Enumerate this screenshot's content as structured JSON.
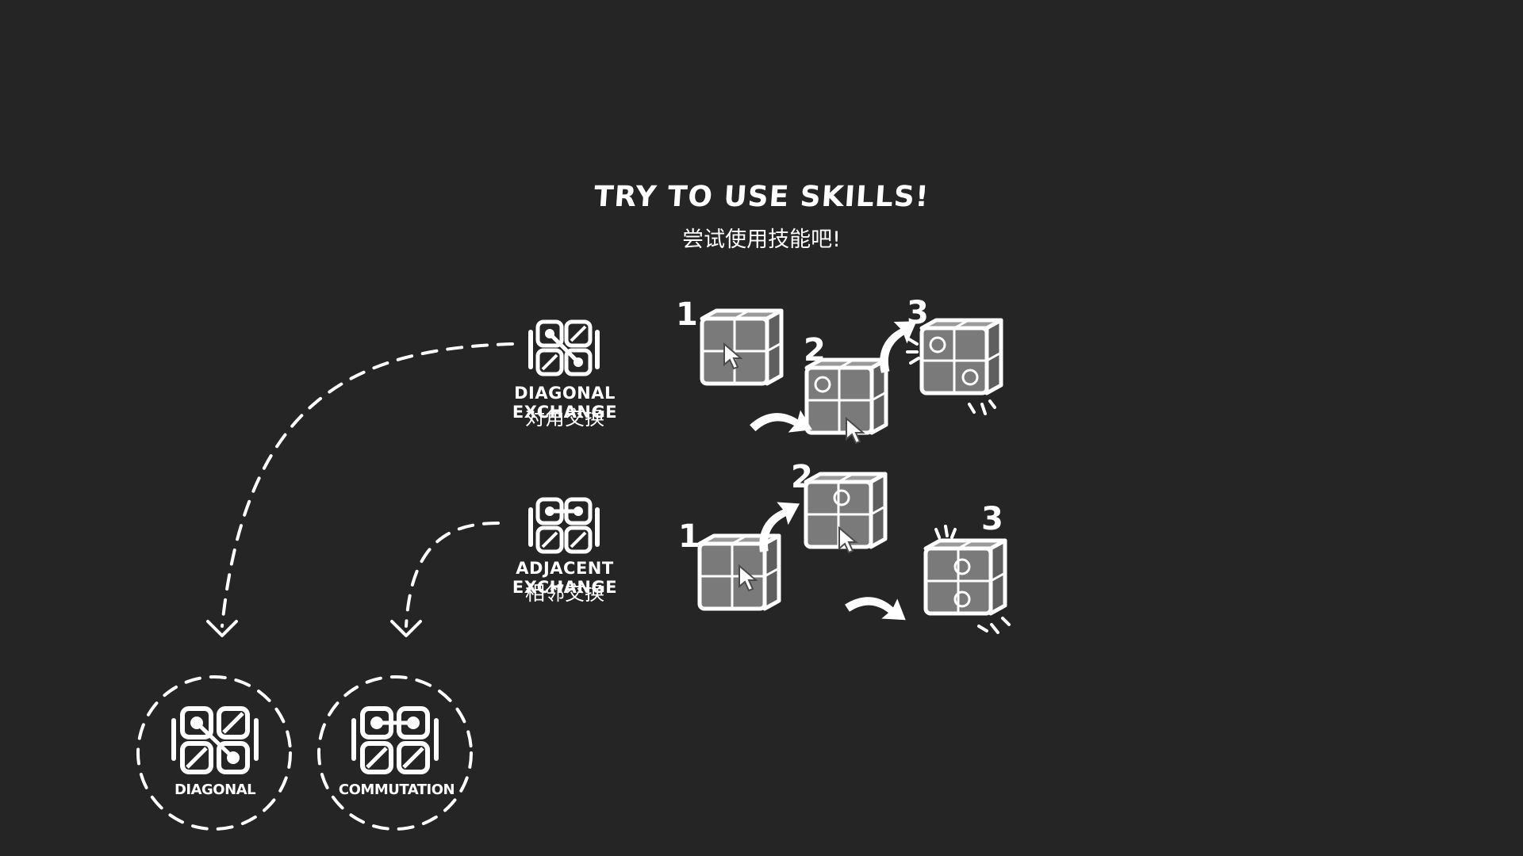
{
  "title": {
    "en": "TRY TO USE SKILLS!",
    "cn": "尝试使用技能吧!"
  },
  "skills": [
    {
      "name_en": "DIAGONAL EXCHANGE",
      "name_cn": "对角交换",
      "icon": "diagonal-exchange-icon"
    },
    {
      "name_en": "ADJACENT EXCHANGE",
      "name_cn": "相邻交换",
      "icon": "adjacent-exchange-icon"
    }
  ],
  "steps": {
    "diagonal": [
      "1",
      "2",
      "3"
    ],
    "adjacent": [
      "1",
      "2",
      "3"
    ]
  },
  "badges": [
    {
      "label": "DIAGONAL",
      "icon": "diagonal-skill-icon"
    },
    {
      "label": "COMMUTATION",
      "icon": "commutation-skill-icon"
    }
  ],
  "colors": {
    "background": "#252525",
    "foreground": "#ffffff",
    "cube_face": "#7a7a7a",
    "cube_dark": "#4a4a4a"
  }
}
